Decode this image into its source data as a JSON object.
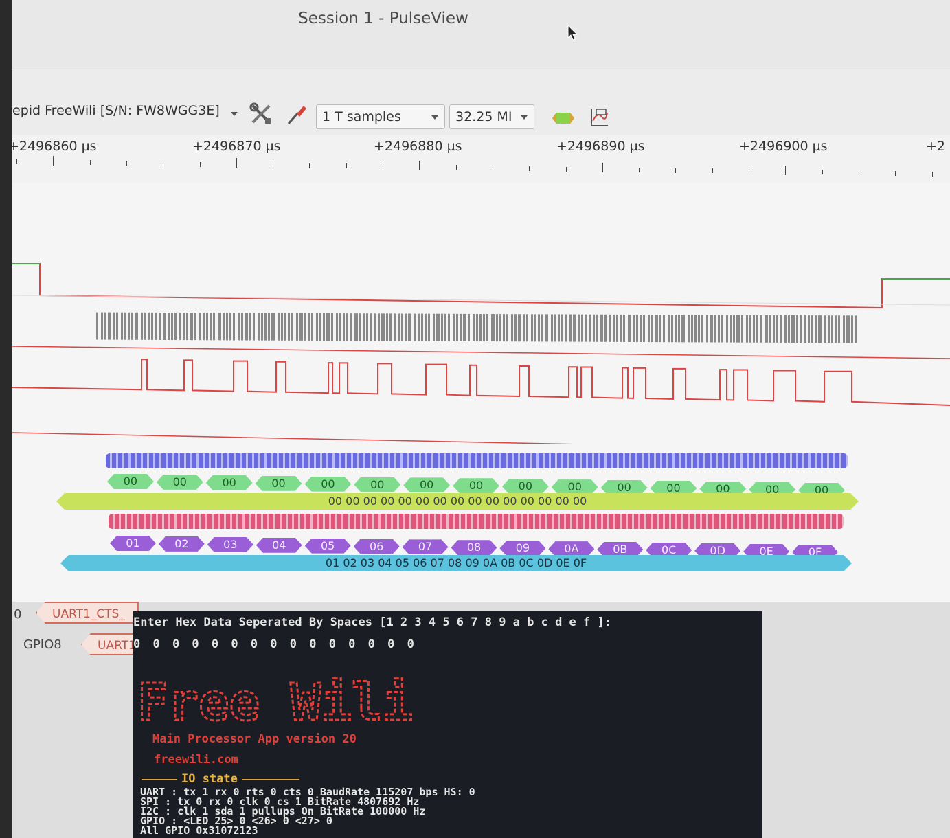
{
  "window": {
    "title": "Session 1 - PulseView"
  },
  "toolbar": {
    "device": "epid FreeWili [S/N: FW8WGG3E]",
    "samples": "1 T samples",
    "samplerate": "32.25 MI"
  },
  "ruler": {
    "labels": [
      "+2496860 µs",
      "+2496870 µs",
      "+2496880 µs",
      "+2496890 µs",
      "+2496900 µs",
      "+2"
    ]
  },
  "decoder": {
    "tx_bytes": [
      "00",
      "00",
      "00",
      "00",
      "00",
      "00",
      "00",
      "00",
      "00",
      "00",
      "00",
      "00",
      "00",
      "00",
      "00"
    ],
    "tx_summary": "00 00 00 00 00 00 00 00 00 00 00 00 00 00 00",
    "rx_bytes": [
      "01",
      "02",
      "03",
      "04",
      "05",
      "06",
      "07",
      "08",
      "09",
      "0A",
      "0B",
      "0C",
      "0D",
      "0E",
      "0F"
    ],
    "rx_summary": "01 02 03 04 05 06 07 08 09 0A 0B 0C 0D 0E 0F"
  },
  "traces": {
    "row1_num": "0",
    "row1_tag": "UART1_CTS_",
    "row2_name": "GPIO8",
    "row2_tag": "UART1"
  },
  "terminal": {
    "prompt": "Enter Hex Data Seperated By Spaces [1 2 3 4 5 6 7 8 9 a b c d e f ]:",
    "input": "0 0 0 0 0 0 0 0 0 0 0 0 0 0 0",
    "logo": "Free Wili",
    "version": "Main Processor App version 20",
    "website": "freewili.com",
    "io_header": "IO state",
    "io_lines": [
      "UART : tx 1 rx 0 rts 0 cts 0 BaudRate 115207 bps HS: 0",
      " SPI : tx 0 rx 0 clk 0 cs 1 BitRate 4807692 Hz",
      " I2C : clk 1 sda 1 pullups On BitRate 100000 Hz",
      "GPIO : <LED 25> 0 <26> 0 <27> 0",
      "All GPIO 0x31072123"
    ]
  },
  "colors": {
    "accent_green": "#7fdc8c",
    "accent_purple": "#9a5fd6",
    "accent_yellow": "#c9e25b",
    "accent_cyan": "#5bc3dd",
    "terminal_red": "#e0403a"
  }
}
